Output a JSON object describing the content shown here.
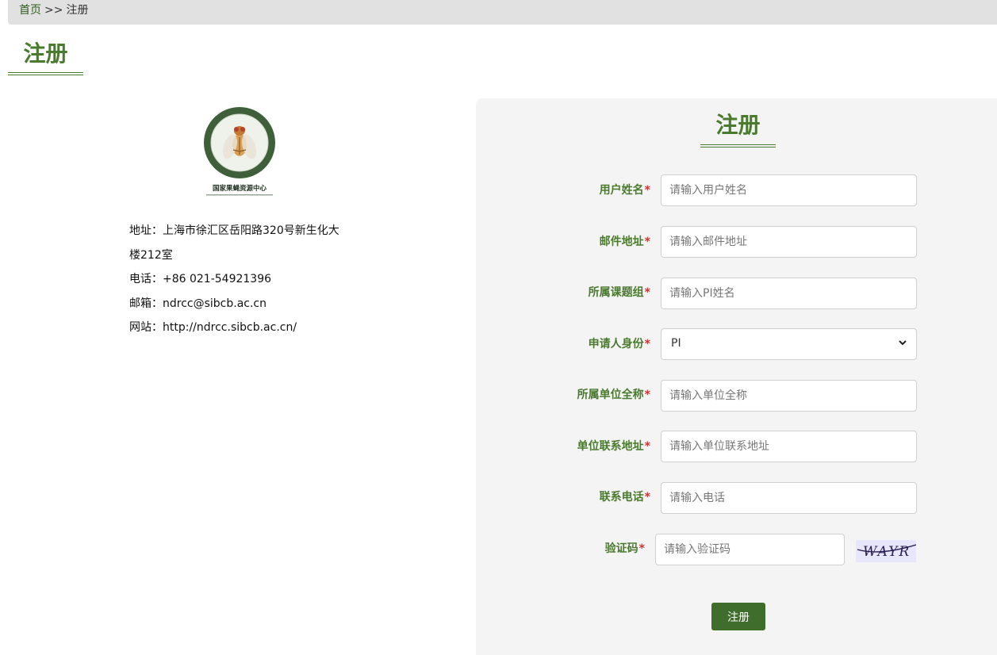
{
  "breadcrumb": {
    "home": "首页",
    "separator": ">>",
    "current": "注册"
  },
  "page_title": "注册",
  "logo": {
    "caption": "国家果蝇资源中心"
  },
  "contact": {
    "address_line1": "地址：上海市徐汇区岳阳路320号新生化大",
    "address_line2": "楼212室",
    "phone": "电话：+86 021-54921396",
    "email": "邮箱：ndrcc@sibcb.ac.cn",
    "website": "网站：http://ndrcc.sibcb.ac.cn/"
  },
  "form": {
    "title": "注册",
    "required_mark": "*",
    "fields": {
      "username": {
        "label": "用户姓名",
        "placeholder": "请输入用户姓名"
      },
      "email": {
        "label": "邮件地址",
        "placeholder": "请输入邮件地址"
      },
      "group": {
        "label": "所属课题组",
        "placeholder": "请输入PI姓名"
      },
      "role": {
        "label": "申请人身份",
        "value": "PI"
      },
      "institution": {
        "label": "所属单位全称",
        "placeholder": "请输入单位全称"
      },
      "inst_address": {
        "label": "单位联系地址",
        "placeholder": "请输入单位联系地址"
      },
      "phone": {
        "label": "联系电话",
        "placeholder": "请输入电话"
      },
      "captcha": {
        "label": "验证码",
        "placeholder": "请输入验证码",
        "image_text": "WAYR"
      }
    },
    "submit_label": "注册"
  },
  "colors": {
    "accent": "#4a7a2e",
    "button": "#3f6e2c",
    "required": "#d32f2f",
    "panel": "#f4f4f4"
  }
}
